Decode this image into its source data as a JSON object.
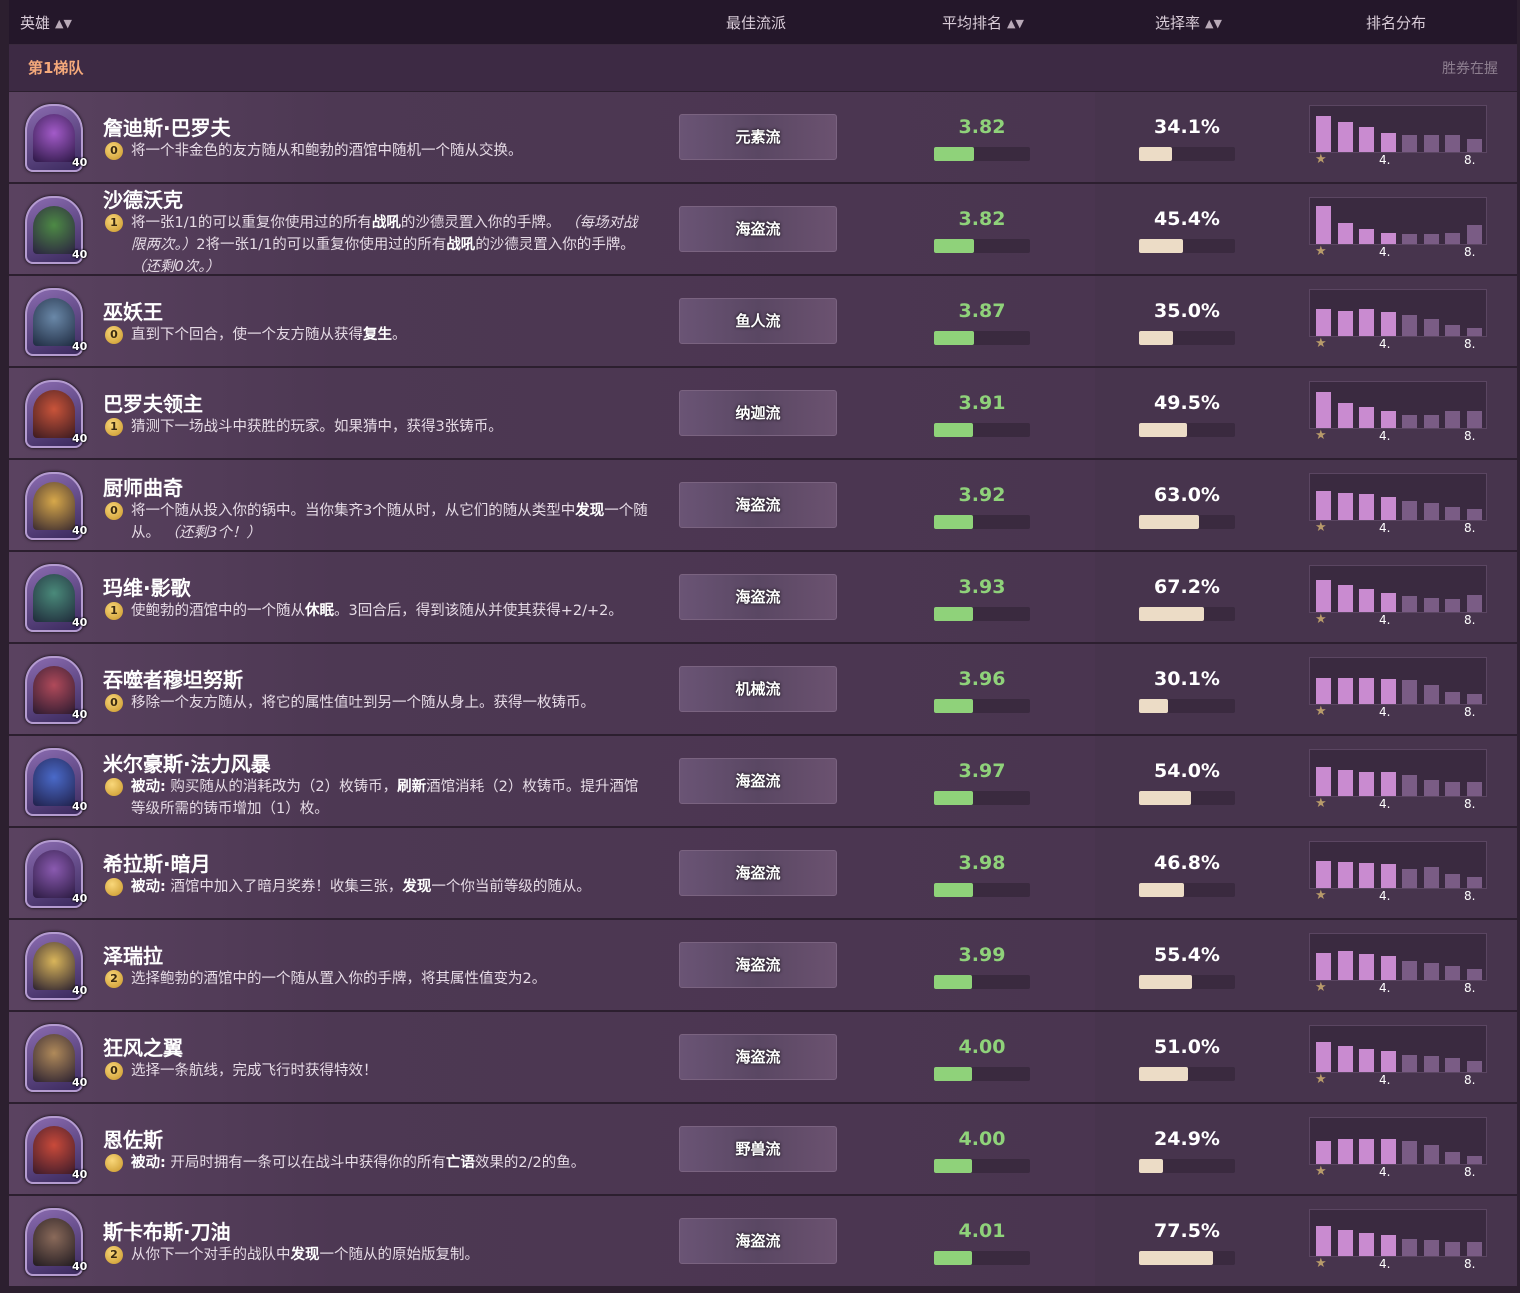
{
  "header": {
    "hero": "英雄",
    "best": "最佳流派",
    "avg": "平均排名",
    "pick": "选择率",
    "dist": "排名分布"
  },
  "tier": {
    "label": "第1梯队",
    "right": "胜券在握"
  },
  "dist_labels": {
    "mid": "4.",
    "end": "8."
  },
  "colors": {
    "avg_green": "#8fd27a",
    "pick_cream": "#ecdcc6",
    "top_bar": "#c98bd0",
    "low_bar": "#7a5c85",
    "tier_orange": "#f4a97b"
  },
  "rows": [
    {
      "name": "詹迪斯·巴罗夫",
      "cost": "0",
      "desc": "将一个非金色的友方随从和鲍勃的酒馆中随机一个随从交换。",
      "arch": "元素流",
      "avg": "3.82",
      "avg_num": 3.82,
      "pick": "34.1%",
      "pick_num": 34.1,
      "dist": [
        0.95,
        0.8,
        0.65,
        0.5,
        0.45,
        0.45,
        0.45,
        0.35
      ],
      "face": [
        "#a35bc9",
        "#2b1744"
      ],
      "lvl": "40"
    },
    {
      "name": "沙德沃克",
      "cost": "1",
      "desc": "将一张1/1的可以重复你使用过的所有<b>战吼</b>的沙德灵置入你的手牌。 <i>（每场对战限两次。）</i>2将一张1/1的可以重复你使用过的所有<b>战吼</b>的沙德灵置入你的手牌。 <i>（还剩0次。）</i>",
      "arch": "海盗流",
      "avg": "3.82",
      "avg_num": 3.82,
      "pick": "45.4%",
      "pick_num": 45.4,
      "dist": [
        1.0,
        0.55,
        0.4,
        0.3,
        0.25,
        0.25,
        0.3,
        0.5
      ],
      "face": [
        "#4d8a45",
        "#2a2040"
      ],
      "lvl": "40"
    },
    {
      "name": "巫妖王",
      "cost": "0",
      "desc": "直到下个回合，使一个友方随从获得<b>复生</b>。",
      "arch": "鱼人流",
      "avg": "3.87",
      "avg_num": 3.87,
      "pick": "35.0%",
      "pick_num": 35.0,
      "dist": [
        0.7,
        0.65,
        0.7,
        0.62,
        0.55,
        0.45,
        0.3,
        0.2
      ],
      "face": [
        "#6a88a8",
        "#1e2a40"
      ],
      "lvl": "40"
    },
    {
      "name": "巴罗夫领主",
      "cost": "1",
      "desc": "猜测下一场战斗中获胜的玩家。如果猜中，获得3张铸币。",
      "arch": "纳迦流",
      "avg": "3.91",
      "avg_num": 3.91,
      "pick": "49.5%",
      "pick_num": 49.5,
      "dist": [
        0.95,
        0.65,
        0.55,
        0.45,
        0.35,
        0.35,
        0.45,
        0.45
      ],
      "face": [
        "#c9543a",
        "#3a1a20"
      ],
      "lvl": "40"
    },
    {
      "name": "厨师曲奇",
      "cost": "0",
      "desc": "将一个随从投入你的锅中。当你集齐3个随从时，从它们的随从类型中<b>发现</b>一个随从。 <i>（还剩3个！）</i>",
      "arch": "海盗流",
      "avg": "3.92",
      "avg_num": 3.92,
      "pick": "63.0%",
      "pick_num": 63.0,
      "dist": [
        0.75,
        0.72,
        0.68,
        0.6,
        0.5,
        0.45,
        0.35,
        0.3
      ],
      "face": [
        "#d7a84a",
        "#3a2a30"
      ],
      "lvl": "40"
    },
    {
      "name": "玛维·影歌",
      "cost": "1",
      "desc": "使鲍勃的酒馆中的一个随从<b>休眠</b>。3回合后，得到该随从并使其获得+2/+2。",
      "arch": "海盗流",
      "avg": "3.93",
      "avg_num": 3.93,
      "pick": "67.2%",
      "pick_num": 67.2,
      "dist": [
        0.85,
        0.72,
        0.6,
        0.5,
        0.42,
        0.38,
        0.35,
        0.45
      ],
      "face": [
        "#4a8a7a",
        "#1f2a3a"
      ],
      "lvl": "40"
    },
    {
      "name": "吞噬者穆坦努斯",
      "cost": "0",
      "desc": "移除一个友方随从，将它的属性值吐到另一个随从身上。获得一枚铸币。",
      "arch": "机械流",
      "avg": "3.96",
      "avg_num": 3.96,
      "pick": "30.1%",
      "pick_num": 30.1,
      "dist": [
        0.68,
        0.68,
        0.68,
        0.66,
        0.62,
        0.5,
        0.32,
        0.25
      ],
      "face": [
        "#b04a5a",
        "#2a1a30"
      ],
      "lvl": "40"
    },
    {
      "name": "米尔豪斯·法力风暴",
      "cost": "passive",
      "desc": "<b>被动:</b> 购买随从的消耗改为（2）枚铸币，<b>刷新</b>酒馆消耗（2）枚铸币。提升酒馆等级所需的铸币增加（1）枚。",
      "arch": "海盗流",
      "avg": "3.97",
      "avg_num": 3.97,
      "pick": "54.0%",
      "pick_num": 54.0,
      "dist": [
        0.75,
        0.68,
        0.62,
        0.62,
        0.55,
        0.42,
        0.38,
        0.38
      ],
      "face": [
        "#4a6ac9",
        "#20204a"
      ],
      "lvl": "40"
    },
    {
      "name": "希拉斯·暗月",
      "cost": "passive",
      "desc": "<b>被动:</b> 酒馆中加入了暗月奖券！收集三张，<b>发现</b>一个你当前等级的随从。",
      "arch": "海盗流",
      "avg": "3.98",
      "avg_num": 3.98,
      "pick": "46.8%",
      "pick_num": 46.8,
      "dist": [
        0.72,
        0.68,
        0.66,
        0.64,
        0.5,
        0.55,
        0.38,
        0.3
      ],
      "face": [
        "#8a5ab0",
        "#2a1a40"
      ],
      "lvl": "40"
    },
    {
      "name": "泽瑞拉",
      "cost": "2",
      "desc": "选择鲍勃的酒馆中的一个随从置入你的手牌，将其属性值变为2。",
      "arch": "海盗流",
      "avg": "3.99",
      "avg_num": 3.99,
      "pick": "55.4%",
      "pick_num": 55.4,
      "dist": [
        0.72,
        0.75,
        0.68,
        0.62,
        0.5,
        0.45,
        0.38,
        0.3
      ],
      "face": [
        "#d9b55a",
        "#2a2030"
      ],
      "lvl": "40"
    },
    {
      "name": "狂风之翼",
      "cost": "0",
      "desc": "选择一条航线，完成飞行时获得特效！",
      "arch": "海盗流",
      "avg": "4.00",
      "avg_num": 4.0,
      "pick": "51.0%",
      "pick_num": 51.0,
      "dist": [
        0.8,
        0.68,
        0.6,
        0.55,
        0.45,
        0.42,
        0.38,
        0.3
      ],
      "face": [
        "#b08a5a",
        "#2a2030"
      ],
      "lvl": "40"
    },
    {
      "name": "恩佐斯",
      "cost": "passive",
      "desc": "<b>被动:</b> 开局时拥有一条可以在战斗中获得你的所有<b>亡语</b>效果的2/2的鱼。",
      "arch": "野兽流",
      "avg": "4.00",
      "avg_num": 4.0,
      "pick": "24.9%",
      "pick_num": 24.9,
      "dist": [
        0.6,
        0.65,
        0.65,
        0.65,
        0.6,
        0.5,
        0.32,
        0.22
      ],
      "face": [
        "#c94a3a",
        "#3a1a2a"
      ],
      "lvl": "40"
    },
    {
      "name": "斯卡布斯·刀油",
      "cost": "2",
      "desc": "从你下一个对手的战队中<b>发现</b>一个随从的原始版复制。",
      "arch": "海盗流",
      "avg": "4.01",
      "avg_num": 4.01,
      "pick": "77.5%",
      "pick_num": 77.5,
      "dist": [
        0.78,
        0.68,
        0.6,
        0.55,
        0.45,
        0.42,
        0.38,
        0.38
      ],
      "face": [
        "#8a6a5a",
        "#201a20"
      ],
      "lvl": "40"
    }
  ]
}
